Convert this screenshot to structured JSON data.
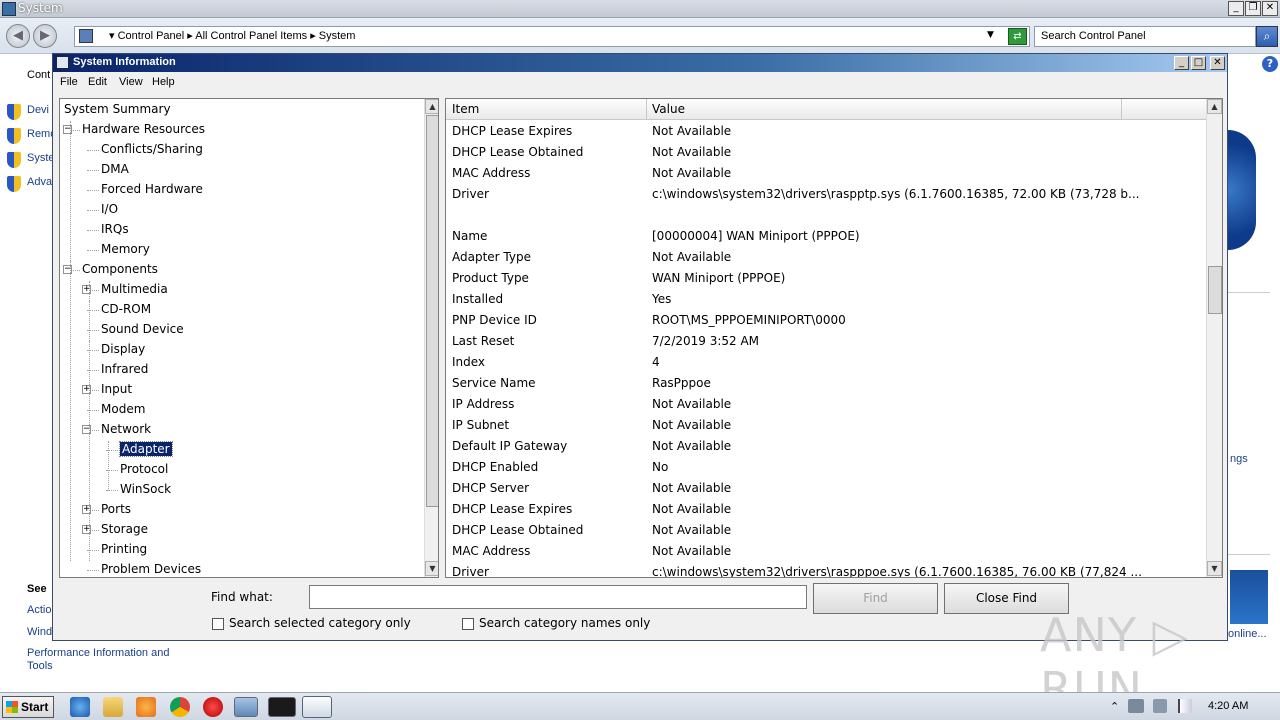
{
  "outer_window": {
    "title": "System",
    "breadcrumb": "▾  Control Panel  ▸  All Control Panel Items  ▸  System",
    "search_placeholder": "Search Control Panel",
    "left_items": [
      "Cont",
      "Devi",
      "Remo",
      "Syste",
      "Adva"
    ],
    "see_also": "See",
    "see_items": [
      "Actio",
      "Wind"
    ],
    "perf_link": "Performance Information and Tools",
    "right_link_fragment": "ngs",
    "right_online_fragment": "online..."
  },
  "msinfo": {
    "title": "System Information",
    "menu": [
      "File",
      "Edit",
      "View",
      "Help"
    ],
    "tree": [
      {
        "label": "System Summary",
        "level": 0,
        "exp": ""
      },
      {
        "label": "Hardware Resources",
        "level": 1,
        "exp": "-"
      },
      {
        "label": "Conflicts/Sharing",
        "level": 2,
        "exp": ""
      },
      {
        "label": "DMA",
        "level": 2,
        "exp": ""
      },
      {
        "label": "Forced Hardware",
        "level": 2,
        "exp": ""
      },
      {
        "label": "I/O",
        "level": 2,
        "exp": ""
      },
      {
        "label": "IRQs",
        "level": 2,
        "exp": ""
      },
      {
        "label": "Memory",
        "level": 2,
        "exp": ""
      },
      {
        "label": "Components",
        "level": 1,
        "exp": "-"
      },
      {
        "label": "Multimedia",
        "level": 2,
        "exp": "+"
      },
      {
        "label": "CD-ROM",
        "level": 2,
        "exp": ""
      },
      {
        "label": "Sound Device",
        "level": 2,
        "exp": ""
      },
      {
        "label": "Display",
        "level": 2,
        "exp": ""
      },
      {
        "label": "Infrared",
        "level": 2,
        "exp": ""
      },
      {
        "label": "Input",
        "level": 2,
        "exp": "+"
      },
      {
        "label": "Modem",
        "level": 2,
        "exp": ""
      },
      {
        "label": "Network",
        "level": 2,
        "exp": "-"
      },
      {
        "label": "Adapter",
        "level": 3,
        "exp": "",
        "selected": true
      },
      {
        "label": "Protocol",
        "level": 3,
        "exp": ""
      },
      {
        "label": "WinSock",
        "level": 3,
        "exp": ""
      },
      {
        "label": "Ports",
        "level": 2,
        "exp": "+"
      },
      {
        "label": "Storage",
        "level": 2,
        "exp": "+"
      },
      {
        "label": "Printing",
        "level": 2,
        "exp": ""
      },
      {
        "label": "Problem Devices",
        "level": 2,
        "exp": ""
      }
    ],
    "columns": {
      "item": "Item",
      "value": "Value"
    },
    "rows": [
      {
        "item": "DHCP Lease Expires",
        "value": "Not Available"
      },
      {
        "item": "DHCP Lease Obtained",
        "value": "Not Available"
      },
      {
        "item": "MAC Address",
        "value": "Not Available"
      },
      {
        "item": "Driver",
        "value": "c:\\windows\\system32\\drivers\\raspptp.sys (6.1.7600.16385, 72.00 KB (73,728 b..."
      },
      {
        "item": "",
        "value": ""
      },
      {
        "item": "Name",
        "value": "[00000004] WAN Miniport (PPPOE)"
      },
      {
        "item": "Adapter Type",
        "value": "Not Available"
      },
      {
        "item": "Product Type",
        "value": "WAN Miniport (PPPOE)"
      },
      {
        "item": "Installed",
        "value": "Yes"
      },
      {
        "item": "PNP Device ID",
        "value": "ROOT\\MS_PPPOEMINIPORT\\0000"
      },
      {
        "item": "Last Reset",
        "value": "7/2/2019 3:52 AM"
      },
      {
        "item": "Index",
        "value": "4"
      },
      {
        "item": "Service Name",
        "value": "RasPppoe"
      },
      {
        "item": "IP Address",
        "value": "Not Available"
      },
      {
        "item": "IP Subnet",
        "value": "Not Available"
      },
      {
        "item": "Default IP Gateway",
        "value": "Not Available"
      },
      {
        "item": "DHCP Enabled",
        "value": "No"
      },
      {
        "item": "DHCP Server",
        "value": "Not Available"
      },
      {
        "item": "DHCP Lease Expires",
        "value": "Not Available"
      },
      {
        "item": "DHCP Lease Obtained",
        "value": "Not Available"
      },
      {
        "item": "MAC Address",
        "value": "Not Available"
      },
      {
        "item": "Driver",
        "value": "c:\\windows\\system32\\drivers\\raspppoe.sys (6.1.7600.16385, 76.00 KB (77,824 ..."
      }
    ],
    "find": {
      "label": "Find what:",
      "value": "",
      "find_button": "Find",
      "close_button": "Close Find",
      "opt_selected": "Search selected category only",
      "opt_names": "Search category names only"
    }
  },
  "taskbar": {
    "start": "Start",
    "clock": "4:20 AM"
  },
  "watermark": "ANY ▷ RUN"
}
